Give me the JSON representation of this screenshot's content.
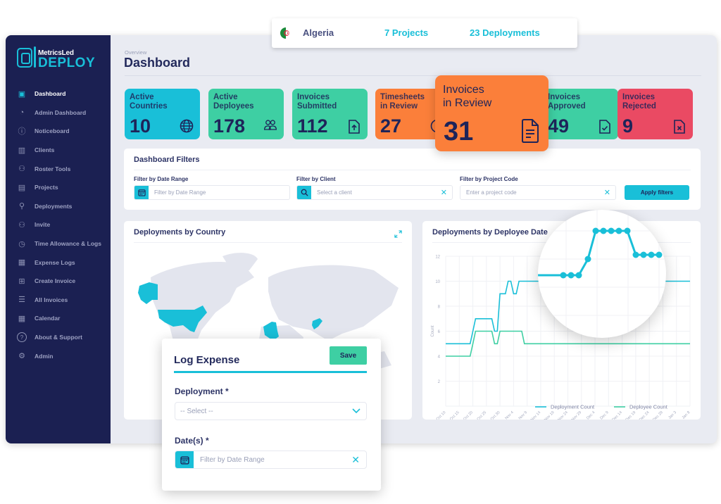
{
  "app": {
    "logo_small": "MetricsLed",
    "logo_big": "DEPLOY"
  },
  "sidebar": {
    "items": [
      {
        "label": "Dashboard",
        "icon": "dashboard-icon",
        "active": true
      },
      {
        "label": "Admin Dashboard",
        "icon": "gauge-icon"
      },
      {
        "label": "Noticeboard",
        "icon": "info-icon"
      },
      {
        "label": "Clients",
        "icon": "building-icon"
      },
      {
        "label": "Roster Tools",
        "icon": "users-icon"
      },
      {
        "label": "Projects",
        "icon": "kanban-icon"
      },
      {
        "label": "Deployments",
        "icon": "map-pin-icon"
      },
      {
        "label": "Invite",
        "icon": "user-plus-icon"
      },
      {
        "label": "Time Allowance & Logs",
        "icon": "clock-icon"
      },
      {
        "label": "Expense Logs",
        "icon": "receipt-icon"
      },
      {
        "label": "Create Invoice",
        "icon": "file-plus-icon"
      },
      {
        "label": "All Invoices",
        "icon": "list-icon"
      },
      {
        "label": "Calendar",
        "icon": "calendar-icon"
      },
      {
        "label": "About & Support",
        "icon": "help-icon"
      },
      {
        "label": "Admin",
        "icon": "gear-icon"
      }
    ]
  },
  "header": {
    "breadcrumb": "Overview",
    "title": "Dashboard"
  },
  "country_popup": {
    "country": "Algeria",
    "projects": "7 Projects",
    "deployments": "23 Deployments"
  },
  "stats": [
    {
      "label_1": "Active",
      "label_2": "Countries",
      "value": "10",
      "icon": "globe-icon",
      "color": "#19bfd8"
    },
    {
      "label_1": "Active",
      "label_2": "Deployees",
      "value": "178",
      "icon": "users-icon",
      "color": "#3ecfa3"
    },
    {
      "label_1": "Invoices",
      "label_2": "Submitted",
      "value": "112",
      "icon": "file-upload-icon",
      "color": "#3ecfa3"
    },
    {
      "label_1": "Timesheets",
      "label_2": "in Review",
      "value": "27",
      "icon": "alert-circle-icon",
      "color": "#fb7f3a"
    },
    {
      "label_1": "Invoices",
      "label_2": "in Review",
      "value": "31",
      "icon": "file-text-icon",
      "color": "#fb7f3a"
    },
    {
      "label_1": "Invoices",
      "label_2": "Approved",
      "value": "49",
      "icon": "file-check-icon",
      "color": "#3ecfa3"
    },
    {
      "label_1": "Invoices",
      "label_2": "Rejected",
      "value": "9",
      "icon": "file-x-icon",
      "color": "#ea4a63"
    }
  ],
  "filters": {
    "title": "Dashboard Filters",
    "date_label": "Filter by Date Range",
    "date_placeholder": "Filter by Date Range",
    "client_label": "Filter by Client",
    "client_placeholder": "Select a client",
    "project_label": "Filter by Project Code",
    "project_placeholder": "Enter a project code",
    "apply_label": "Apply filters"
  },
  "map_panel": {
    "title": "Deployments by Country",
    "highlighted_countries": [
      "United States",
      "Algeria",
      "Afghanistan"
    ]
  },
  "chart_panel": {
    "title": "Deployments by Deployee Date"
  },
  "modal": {
    "title": "Log Expense",
    "save_label": "Save",
    "deployment_label": "Deployment *",
    "deployment_placeholder": "-- Select --",
    "dates_label": "Date(s) *",
    "dates_placeholder": "Filter by Date Range"
  },
  "colors": {
    "accent": "#19bfd8",
    "green": "#3ecfa3",
    "orange": "#fb7f3a",
    "red": "#ea4a63",
    "navy": "#1b2052"
  },
  "chart_data": {
    "type": "line",
    "title": "Deployments by Deployee Date",
    "xlabel": "",
    "ylabel": "Count",
    "ylim": [
      0,
      12
    ],
    "yticks": [
      2,
      4,
      6,
      8,
      10,
      12
    ],
    "grid": true,
    "legend": "bottom-right",
    "x_ticks": [
      "Oct 10",
      "Oct 15",
      "Oct 20",
      "Oct 25",
      "Oct 30",
      "Nov 4",
      "Nov 9",
      "Nov 14",
      "Nov 19",
      "Nov 24",
      "Nov 29",
      "Dec 4",
      "Dec 9",
      "Dec 14",
      "Dec 19",
      "Dec 24",
      "Dec 29",
      "Jan 3",
      "Jan 8"
    ],
    "x_days": [
      0,
      9,
      10,
      11,
      17,
      18,
      19,
      20,
      22,
      23,
      24,
      25,
      26,
      27,
      28,
      29,
      90
    ],
    "series": [
      {
        "name": "Deployment Count",
        "color": "#19bfd8",
        "values": [
          5,
          5,
          6,
          7,
          7,
          6,
          6,
          9,
          9,
          10,
          10,
          9,
          9,
          10,
          10,
          10,
          10
        ]
      },
      {
        "name": "Deployee Count",
        "color": "#3ecfa3",
        "values": [
          4,
          4,
          5,
          6,
          6,
          5,
          5,
          6,
          6,
          6,
          6,
          6,
          6,
          6,
          6,
          5,
          5
        ]
      }
    ]
  }
}
